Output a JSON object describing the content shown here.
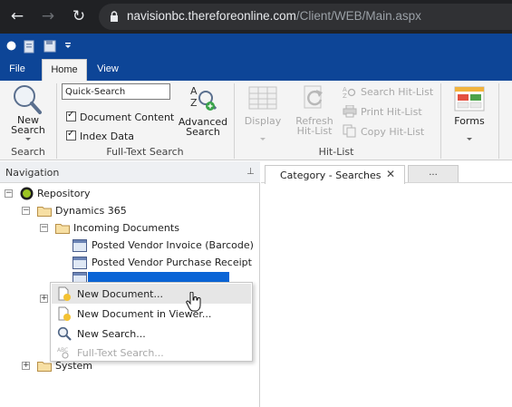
{
  "browser": {
    "url_host": "navisionbc.thereforeonline.com",
    "url_path": "/Client/WEB/Main.aspx"
  },
  "menu": {
    "tabs": [
      {
        "label": "File",
        "active": false
      },
      {
        "label": "Home",
        "active": true
      },
      {
        "label": "View",
        "active": false
      }
    ]
  },
  "ribbon": {
    "new_search": {
      "line1": "New",
      "line2": "Search"
    },
    "quick_search_value": "Quick-Search",
    "document_content_label": "Document Content",
    "index_data_label": "Index Data",
    "advanced_search": {
      "line1": "Advanced",
      "line2": "Search"
    },
    "display_label": "Display",
    "refresh_hitlist": {
      "line1": "Refresh",
      "line2": "Hit-List"
    },
    "search_hitlist_label": "Search Hit-List",
    "print_hitlist_label": "Print Hit-List",
    "copy_hitlist_label": "Copy Hit-List",
    "forms_label": "Forms",
    "groups": {
      "search": "Search",
      "full_text_search": "Full-Text Search",
      "hit_list": "Hit-List"
    }
  },
  "navigation": {
    "title": "Navigation",
    "tree": {
      "repository": "Repository",
      "dynamics": "Dynamics 365",
      "incoming": "Incoming Documents",
      "posted_vendor_invoice": "Posted Vendor Invoice (Barcode)",
      "posted_vendor_purchase": "Posted Vendor Purchase Receipt",
      "system": "System"
    }
  },
  "context_menu": {
    "new_document": "New Document...",
    "new_document_viewer": "New Document in Viewer...",
    "new_search": "New Search...",
    "full_text_search": "Full-Text Search..."
  },
  "content": {
    "tab_label": "Category - Searches",
    "more_label": "..."
  },
  "colors": {
    "brand_blue": "#0d4597",
    "selection_blue": "#0a64d6",
    "browser_dark": "#202124"
  }
}
